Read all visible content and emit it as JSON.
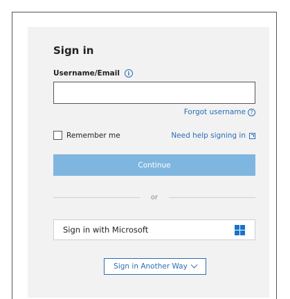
{
  "signin": {
    "title": "Sign in",
    "username_label": "Username/Email",
    "username_value": "",
    "username_placeholder": "",
    "forgot_username": "Forgot username",
    "remember_me": "Remember me",
    "need_help": "Need help signing in",
    "continue_label": "Continue",
    "divider_text": "or",
    "microsoft_label": "Sign in with Microsoft",
    "another_way_label": "Sign in Another Way"
  },
  "icons": {
    "info": "info-icon",
    "help": "question-circle-icon",
    "external": "external-link-icon",
    "windows": "windows-logo-icon",
    "chevron": "chevron-down-icon"
  },
  "colors": {
    "link": "#2a6db5",
    "continue_button": "#7fb6df",
    "panel_background": "#f2f2f2",
    "windows_logo": "#1a73c8"
  }
}
